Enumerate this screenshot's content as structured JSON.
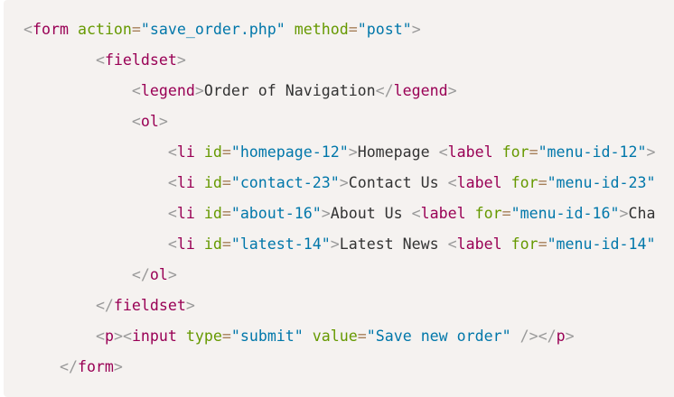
{
  "code": {
    "language": "html",
    "lines": [
      {
        "indent": 0,
        "tokens": [
          {
            "t": "<",
            "c": "punct"
          },
          {
            "t": "form",
            "c": "tag"
          },
          {
            "t": " ",
            "c": "text"
          },
          {
            "t": "action",
            "c": "attr"
          },
          {
            "t": "=",
            "c": "eq"
          },
          {
            "t": "\"save_order.php\"",
            "c": "val"
          },
          {
            "t": " ",
            "c": "text"
          },
          {
            "t": "method",
            "c": "attr"
          },
          {
            "t": "=",
            "c": "eq"
          },
          {
            "t": "\"post\"",
            "c": "val"
          },
          {
            "t": ">",
            "c": "punct"
          }
        ]
      },
      {
        "indent": 8,
        "tokens": [
          {
            "t": "<",
            "c": "punct"
          },
          {
            "t": "fieldset",
            "c": "tag"
          },
          {
            "t": ">",
            "c": "punct"
          }
        ]
      },
      {
        "indent": 12,
        "tokens": [
          {
            "t": "<",
            "c": "punct"
          },
          {
            "t": "legend",
            "c": "tag"
          },
          {
            "t": ">",
            "c": "punct"
          },
          {
            "t": "Order of Navigation",
            "c": "text"
          },
          {
            "t": "</",
            "c": "punct"
          },
          {
            "t": "legend",
            "c": "tag"
          },
          {
            "t": ">",
            "c": "punct"
          }
        ]
      },
      {
        "indent": 12,
        "tokens": [
          {
            "t": "<",
            "c": "punct"
          },
          {
            "t": "ol",
            "c": "tag"
          },
          {
            "t": ">",
            "c": "punct"
          }
        ]
      },
      {
        "indent": 16,
        "tokens": [
          {
            "t": "<",
            "c": "punct"
          },
          {
            "t": "li",
            "c": "tag"
          },
          {
            "t": " ",
            "c": "text"
          },
          {
            "t": "id",
            "c": "attr"
          },
          {
            "t": "=",
            "c": "eq"
          },
          {
            "t": "\"homepage-12\"",
            "c": "val"
          },
          {
            "t": ">",
            "c": "punct"
          },
          {
            "t": "Homepage ",
            "c": "text"
          },
          {
            "t": "<",
            "c": "punct"
          },
          {
            "t": "label",
            "c": "tag"
          },
          {
            "t": " ",
            "c": "text"
          },
          {
            "t": "for",
            "c": "attr"
          },
          {
            "t": "=",
            "c": "eq"
          },
          {
            "t": "\"menu-id-12\"",
            "c": "val"
          },
          {
            "t": ">",
            "c": "punct"
          }
        ]
      },
      {
        "indent": 16,
        "tokens": [
          {
            "t": "<",
            "c": "punct"
          },
          {
            "t": "li",
            "c": "tag"
          },
          {
            "t": " ",
            "c": "text"
          },
          {
            "t": "id",
            "c": "attr"
          },
          {
            "t": "=",
            "c": "eq"
          },
          {
            "t": "\"contact-23\"",
            "c": "val"
          },
          {
            "t": ">",
            "c": "punct"
          },
          {
            "t": "Contact Us ",
            "c": "text"
          },
          {
            "t": "<",
            "c": "punct"
          },
          {
            "t": "label",
            "c": "tag"
          },
          {
            "t": " ",
            "c": "text"
          },
          {
            "t": "for",
            "c": "attr"
          },
          {
            "t": "=",
            "c": "eq"
          },
          {
            "t": "\"menu-id-23\"",
            "c": "val"
          }
        ]
      },
      {
        "indent": 16,
        "tokens": [
          {
            "t": "<",
            "c": "punct"
          },
          {
            "t": "li",
            "c": "tag"
          },
          {
            "t": " ",
            "c": "text"
          },
          {
            "t": "id",
            "c": "attr"
          },
          {
            "t": "=",
            "c": "eq"
          },
          {
            "t": "\"about-16\"",
            "c": "val"
          },
          {
            "t": ">",
            "c": "punct"
          },
          {
            "t": "About Us ",
            "c": "text"
          },
          {
            "t": "<",
            "c": "punct"
          },
          {
            "t": "label",
            "c": "tag"
          },
          {
            "t": " ",
            "c": "text"
          },
          {
            "t": "for",
            "c": "attr"
          },
          {
            "t": "=",
            "c": "eq"
          },
          {
            "t": "\"menu-id-16\"",
            "c": "val"
          },
          {
            "t": ">",
            "c": "punct"
          },
          {
            "t": "Cha",
            "c": "text"
          }
        ]
      },
      {
        "indent": 16,
        "tokens": [
          {
            "t": "<",
            "c": "punct"
          },
          {
            "t": "li",
            "c": "tag"
          },
          {
            "t": " ",
            "c": "text"
          },
          {
            "t": "id",
            "c": "attr"
          },
          {
            "t": "=",
            "c": "eq"
          },
          {
            "t": "\"latest-14\"",
            "c": "val"
          },
          {
            "t": ">",
            "c": "punct"
          },
          {
            "t": "Latest News ",
            "c": "text"
          },
          {
            "t": "<",
            "c": "punct"
          },
          {
            "t": "label",
            "c": "tag"
          },
          {
            "t": " ",
            "c": "text"
          },
          {
            "t": "for",
            "c": "attr"
          },
          {
            "t": "=",
            "c": "eq"
          },
          {
            "t": "\"menu-id-14\"",
            "c": "val"
          }
        ]
      },
      {
        "indent": 12,
        "tokens": [
          {
            "t": "</",
            "c": "punct"
          },
          {
            "t": "ol",
            "c": "tag"
          },
          {
            "t": ">",
            "c": "punct"
          }
        ]
      },
      {
        "indent": 8,
        "tokens": [
          {
            "t": "</",
            "c": "punct"
          },
          {
            "t": "fieldset",
            "c": "tag"
          },
          {
            "t": ">",
            "c": "punct"
          }
        ]
      },
      {
        "indent": 8,
        "tokens": [
          {
            "t": "<",
            "c": "punct"
          },
          {
            "t": "p",
            "c": "tag"
          },
          {
            "t": ">",
            "c": "punct"
          },
          {
            "t": "<",
            "c": "punct"
          },
          {
            "t": "input",
            "c": "tag"
          },
          {
            "t": " ",
            "c": "text"
          },
          {
            "t": "type",
            "c": "attr"
          },
          {
            "t": "=",
            "c": "eq"
          },
          {
            "t": "\"submit\"",
            "c": "val"
          },
          {
            "t": " ",
            "c": "text"
          },
          {
            "t": "value",
            "c": "attr"
          },
          {
            "t": "=",
            "c": "eq"
          },
          {
            "t": "\"Save new order\"",
            "c": "val"
          },
          {
            "t": " />",
            "c": "punct"
          },
          {
            "t": "</",
            "c": "punct"
          },
          {
            "t": "p",
            "c": "tag"
          },
          {
            "t": ">",
            "c": "punct"
          }
        ]
      },
      {
        "indent": 4,
        "tokens": [
          {
            "t": "</",
            "c": "punct"
          },
          {
            "t": "form",
            "c": "tag"
          },
          {
            "t": ">",
            "c": "punct"
          }
        ]
      }
    ]
  },
  "colors": {
    "background": "#f5f2f0",
    "punctuation": "#999999",
    "tag": "#990055",
    "attribute": "#669900",
    "operator": "#a67f59",
    "value": "#0077aa",
    "text": "#333333"
  }
}
